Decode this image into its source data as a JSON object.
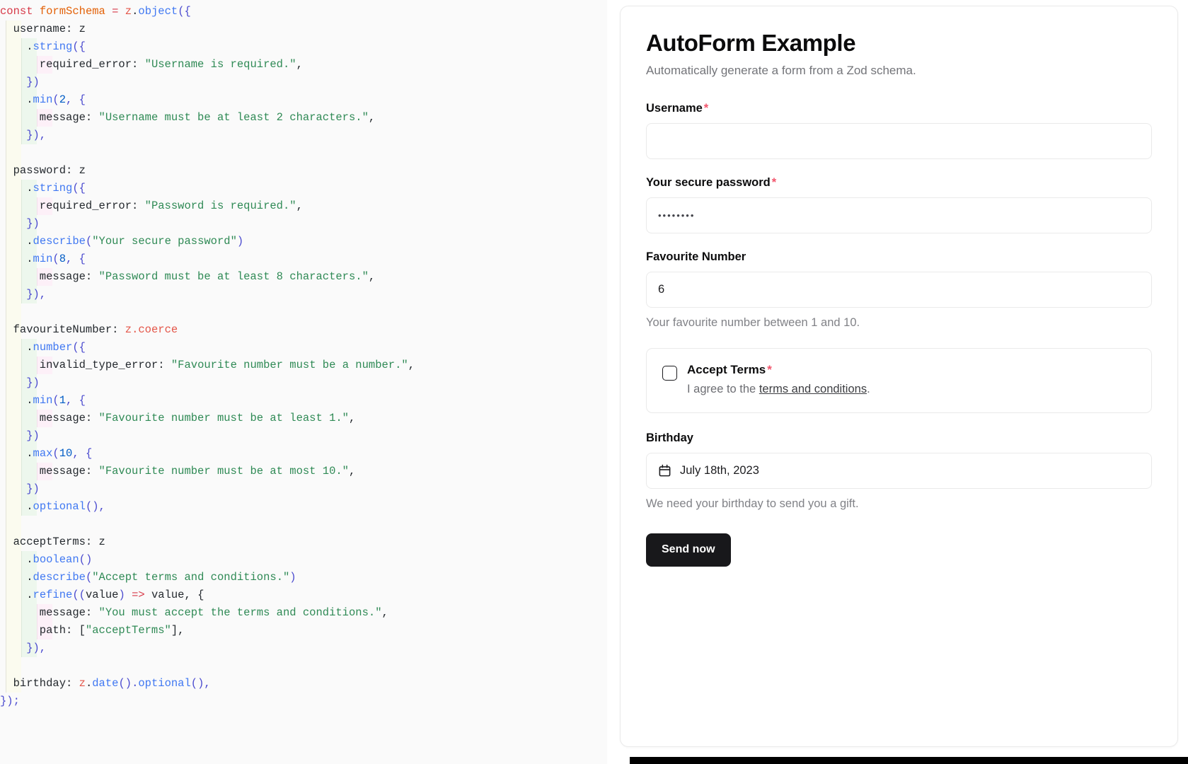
{
  "code_panel": {
    "language": "typescript",
    "lines": [
      [
        {
          "t": "const",
          "c": "kw"
        },
        {
          "t": " ",
          "c": "plain"
        },
        {
          "t": "formSchema",
          "c": "var"
        },
        {
          "t": " ",
          "c": "plain"
        },
        {
          "t": "=",
          "c": "op"
        },
        {
          "t": " ",
          "c": "plain"
        },
        {
          "t": "z",
          "c": "id"
        },
        {
          "t": ".",
          "c": "plain"
        },
        {
          "t": "object",
          "c": "fn"
        },
        {
          "t": "({",
          "c": "pun"
        }
      ],
      [
        {
          "t": "  username",
          "c": "prop"
        },
        {
          "t": ": ",
          "c": "plain"
        },
        {
          "t": "z",
          "c": "plain"
        }
      ],
      [
        {
          "t": "    .",
          "c": "plain"
        },
        {
          "t": "string",
          "c": "fn"
        },
        {
          "t": "({",
          "c": "pun"
        }
      ],
      [
        {
          "t": "      required_error",
          "c": "prop"
        },
        {
          "t": ": ",
          "c": "plain"
        },
        {
          "t": "\"Username is required.\"",
          "c": "str"
        },
        {
          "t": ",",
          "c": "plain"
        }
      ],
      [
        {
          "t": "    })",
          "c": "pun"
        }
      ],
      [
        {
          "t": "    .",
          "c": "plain"
        },
        {
          "t": "min",
          "c": "fn"
        },
        {
          "t": "(",
          "c": "pun"
        },
        {
          "t": "2",
          "c": "num"
        },
        {
          "t": ", {",
          "c": "pun"
        }
      ],
      [
        {
          "t": "      message",
          "c": "prop"
        },
        {
          "t": ": ",
          "c": "plain"
        },
        {
          "t": "\"Username must be at least 2 characters.\"",
          "c": "str"
        },
        {
          "t": ",",
          "c": "plain"
        }
      ],
      [
        {
          "t": "    }),",
          "c": "pun"
        }
      ],
      [
        {
          "t": "",
          "c": "plain"
        }
      ],
      [
        {
          "t": "  password",
          "c": "prop"
        },
        {
          "t": ": ",
          "c": "plain"
        },
        {
          "t": "z",
          "c": "plain"
        }
      ],
      [
        {
          "t": "    .",
          "c": "plain"
        },
        {
          "t": "string",
          "c": "fn"
        },
        {
          "t": "({",
          "c": "pun"
        }
      ],
      [
        {
          "t": "      required_error",
          "c": "prop"
        },
        {
          "t": ": ",
          "c": "plain"
        },
        {
          "t": "\"Password is required.\"",
          "c": "str"
        },
        {
          "t": ",",
          "c": "plain"
        }
      ],
      [
        {
          "t": "    })",
          "c": "pun"
        }
      ],
      [
        {
          "t": "    .",
          "c": "plain"
        },
        {
          "t": "describe",
          "c": "fn"
        },
        {
          "t": "(",
          "c": "pun"
        },
        {
          "t": "\"Your secure password\"",
          "c": "str"
        },
        {
          "t": ")",
          "c": "pun"
        }
      ],
      [
        {
          "t": "    .",
          "c": "plain"
        },
        {
          "t": "min",
          "c": "fn"
        },
        {
          "t": "(",
          "c": "pun"
        },
        {
          "t": "8",
          "c": "num"
        },
        {
          "t": ", {",
          "c": "pun"
        }
      ],
      [
        {
          "t": "      message",
          "c": "prop"
        },
        {
          "t": ": ",
          "c": "plain"
        },
        {
          "t": "\"Password must be at least 8 characters.\"",
          "c": "str"
        },
        {
          "t": ",",
          "c": "plain"
        }
      ],
      [
        {
          "t": "    }),",
          "c": "pun"
        }
      ],
      [
        {
          "t": "",
          "c": "plain"
        }
      ],
      [
        {
          "t": "  favouriteNumber",
          "c": "prop"
        },
        {
          "t": ": ",
          "c": "plain"
        },
        {
          "t": "z",
          "c": "id"
        },
        {
          "t": ".",
          "c": "id"
        },
        {
          "t": "coerce",
          "c": "id"
        }
      ],
      [
        {
          "t": "    .",
          "c": "plain"
        },
        {
          "t": "number",
          "c": "fn"
        },
        {
          "t": "({",
          "c": "pun"
        }
      ],
      [
        {
          "t": "      invalid_type_error",
          "c": "prop"
        },
        {
          "t": ": ",
          "c": "plain"
        },
        {
          "t": "\"Favourite number must be a number.\"",
          "c": "str"
        },
        {
          "t": ",",
          "c": "plain"
        }
      ],
      [
        {
          "t": "    })",
          "c": "pun"
        }
      ],
      [
        {
          "t": "    .",
          "c": "plain"
        },
        {
          "t": "min",
          "c": "fn"
        },
        {
          "t": "(",
          "c": "pun"
        },
        {
          "t": "1",
          "c": "num"
        },
        {
          "t": ", {",
          "c": "pun"
        }
      ],
      [
        {
          "t": "      message",
          "c": "prop"
        },
        {
          "t": ": ",
          "c": "plain"
        },
        {
          "t": "\"Favourite number must be at least 1.\"",
          "c": "str"
        },
        {
          "t": ",",
          "c": "plain"
        }
      ],
      [
        {
          "t": "    })",
          "c": "pun"
        }
      ],
      [
        {
          "t": "    .",
          "c": "plain"
        },
        {
          "t": "max",
          "c": "fn"
        },
        {
          "t": "(",
          "c": "pun"
        },
        {
          "t": "10",
          "c": "num"
        },
        {
          "t": ", {",
          "c": "pun"
        }
      ],
      [
        {
          "t": "      message",
          "c": "prop"
        },
        {
          "t": ": ",
          "c": "plain"
        },
        {
          "t": "\"Favourite number must be at most 10.\"",
          "c": "str"
        },
        {
          "t": ",",
          "c": "plain"
        }
      ],
      [
        {
          "t": "    })",
          "c": "pun"
        }
      ],
      [
        {
          "t": "    .",
          "c": "plain"
        },
        {
          "t": "optional",
          "c": "fn"
        },
        {
          "t": "(),",
          "c": "pun"
        }
      ],
      [
        {
          "t": "",
          "c": "plain"
        }
      ],
      [
        {
          "t": "  acceptTerms",
          "c": "prop"
        },
        {
          "t": ": ",
          "c": "plain"
        },
        {
          "t": "z",
          "c": "plain"
        }
      ],
      [
        {
          "t": "    .",
          "c": "plain"
        },
        {
          "t": "boolean",
          "c": "fn"
        },
        {
          "t": "()",
          "c": "pun"
        }
      ],
      [
        {
          "t": "    .",
          "c": "plain"
        },
        {
          "t": "describe",
          "c": "fn"
        },
        {
          "t": "(",
          "c": "pun"
        },
        {
          "t": "\"Accept terms and conditions.\"",
          "c": "str"
        },
        {
          "t": ")",
          "c": "pun"
        }
      ],
      [
        {
          "t": "    .",
          "c": "plain"
        },
        {
          "t": "refine",
          "c": "fn"
        },
        {
          "t": "((",
          "c": "pun"
        },
        {
          "t": "value",
          "c": "plain"
        },
        {
          "t": ") ",
          "c": "pun"
        },
        {
          "t": "=>",
          "c": "op"
        },
        {
          "t": " value, {",
          "c": "plain"
        }
      ],
      [
        {
          "t": "      message",
          "c": "prop"
        },
        {
          "t": ": ",
          "c": "plain"
        },
        {
          "t": "\"You must accept the terms and conditions.\"",
          "c": "str"
        },
        {
          "t": ",",
          "c": "plain"
        }
      ],
      [
        {
          "t": "      path",
          "c": "prop"
        },
        {
          "t": ": [",
          "c": "plain"
        },
        {
          "t": "\"acceptTerms\"",
          "c": "str"
        },
        {
          "t": "],",
          "c": "plain"
        }
      ],
      [
        {
          "t": "    }),",
          "c": "pun"
        }
      ],
      [
        {
          "t": "",
          "c": "plain"
        }
      ],
      [
        {
          "t": "  birthday",
          "c": "prop"
        },
        {
          "t": ": ",
          "c": "plain"
        },
        {
          "t": "z",
          "c": "id"
        },
        {
          "t": ".",
          "c": "plain"
        },
        {
          "t": "date",
          "c": "fn"
        },
        {
          "t": "().",
          "c": "pun"
        },
        {
          "t": "optional",
          "c": "fn"
        },
        {
          "t": "(),",
          "c": "pun"
        }
      ],
      [
        {
          "t": "});",
          "c": "pun"
        }
      ]
    ]
  },
  "form": {
    "title": "AutoForm Example",
    "subtitle": "Automatically generate a form from a Zod schema.",
    "fields": {
      "username": {
        "label": "Username",
        "required_marker": "*",
        "value": "",
        "placeholder": ""
      },
      "password": {
        "label": "Your secure password",
        "required_marker": "*",
        "value": "••••••••",
        "placeholder": ""
      },
      "favourite_number": {
        "label": "Favourite Number",
        "value": "6",
        "placeholder": "",
        "help": "Your favourite number between 1 and 10."
      },
      "accept_terms": {
        "label": "Accept Terms",
        "required_marker": "*",
        "checked": false,
        "description_prefix": "I agree to the ",
        "link_text": "terms and conditions",
        "description_suffix": "."
      },
      "birthday": {
        "label": "Birthday",
        "value": "July 18th, 2023",
        "help": "We need your birthday to send you a gift.",
        "icon": "calendar-icon"
      }
    },
    "submit_label": "Send now"
  },
  "colors": {
    "accent_required": "#f2556c",
    "button_bg": "#18181b",
    "button_fg": "#ffffff",
    "card_border": "#eaeaea",
    "code_bg": "#fafafa",
    "string_token": "#2f8a55",
    "function_token": "#4078f2",
    "keyword_token": "#d73a49"
  }
}
